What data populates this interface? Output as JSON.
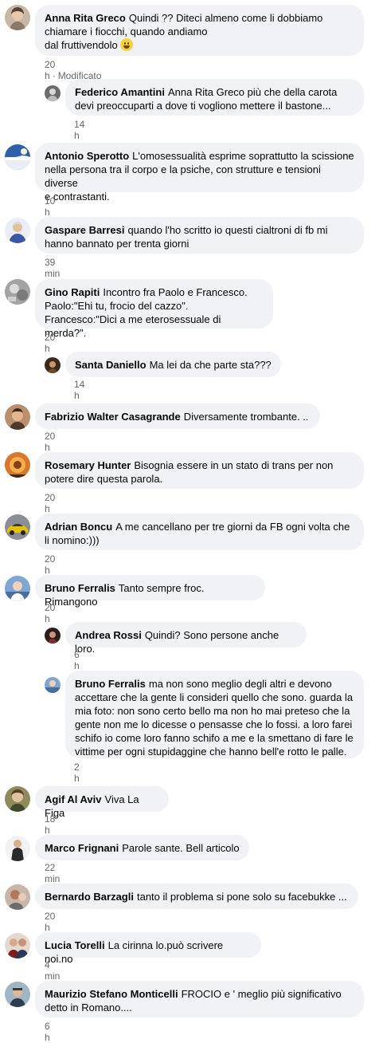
{
  "comments": [
    {
      "author": "Anna Rita Greco",
      "text_lines": [
        "Quindi ?? Diteci almeno come li dobbiamo",
        "chiamare i fiocchi, quando andiamo",
        "dal fruttivendolo"
      ],
      "emoji": "grinning-face",
      "time": "20 h",
      "edited": "Modificato"
    },
    {
      "author": "Federico Amantini",
      "text_lines": [
        "Anna Rita Greco più che della carota",
        "devi preoccuparti a dove ti vogliono mettere il bastone..."
      ],
      "time": "14 h"
    },
    {
      "author": "Antonio Sperotto",
      "text_lines": [
        "L'omosessualità esprime soprattutto la scissione",
        "nella persona tra il corpo e la psiche, con strutture e tensioni diverse",
        "e contrastanti."
      ],
      "time": "10 h"
    },
    {
      "author": "Gaspare Barresi",
      "text_lines": [
        "quando l'ho scritto io questi cialtroni di fb mi",
        "hanno bannato per trenta giorni"
      ],
      "time": "39 min"
    },
    {
      "author": "Gino Rapiti",
      "text_lines": [
        "Incontro fra Paolo e Francesco.",
        "Paolo:\"Ehi tu, frocio del cazzo\".",
        "Francesco:\"Dici a me eterosessuale di merda?\"."
      ],
      "time": "20 h"
    },
    {
      "author": "Santa Daniello",
      "text_lines": [
        "Ma lei da che parte sta???"
      ],
      "time": "14 h"
    },
    {
      "author": "Fabrizio Walter Casagrande",
      "text_lines": [
        "Diversamente trombante. .."
      ],
      "time": "20 h"
    },
    {
      "author": "Rosemary Hunter",
      "text_lines": [
        "Bisognia essere in un stato di trans per non",
        "potere dire questa parola."
      ],
      "time": "20 h"
    },
    {
      "author": "Adrian Boncu",
      "text_lines": [
        "A me cancellano per tre giorni da FB ogni volta che",
        "li nomino:)))"
      ],
      "time": "20 h"
    },
    {
      "author": "Bruno Ferralis",
      "text_lines": [
        "Tanto sempre froc. Rimangono"
      ],
      "time": "20 h"
    },
    {
      "author": "Andrea Rossi",
      "text_lines": [
        "Quindi? Sono persone anche loro."
      ],
      "time": "6 h"
    },
    {
      "author": "Bruno Ferralis",
      "text_lines": [
        "ma non sono meglio degli altri e devono",
        "accettare che la gente li consideri quello che sono. guarda la",
        "mia foto: non sono certo bello ma non ho mai preteso che la",
        "gente non me lo dicesse o pensasse che lo fossi. a loro farei",
        "schifo io come loro fanno schifo a me e la smettano di fare le",
        "vittime per ogni stupidaggine che hanno bell'e rotto le palle."
      ],
      "time": "2 h"
    },
    {
      "author": "Agif Al Aviv",
      "text_lines": [
        "Viva La Figa"
      ],
      "time": "18 h"
    },
    {
      "author": "Marco Frignani",
      "text_lines": [
        "Parole sante. Bell articolo"
      ],
      "time": "22 min"
    },
    {
      "author": "Bernardo Barzagli",
      "text_lines": [
        "tanto il problema si pone solo su facebukke ..."
      ],
      "time": "20 h"
    },
    {
      "author": "Lucia Torelli",
      "text_lines": [
        "La cirinna lo.può scrivere noi.no"
      ],
      "time": "4 min"
    },
    {
      "author": "Maurizio Stefano Monticelli",
      "text_lines": [
        "FROCIO e ' meglio più significativo",
        "detto in Romano...."
      ],
      "time": "6 h"
    }
  ]
}
